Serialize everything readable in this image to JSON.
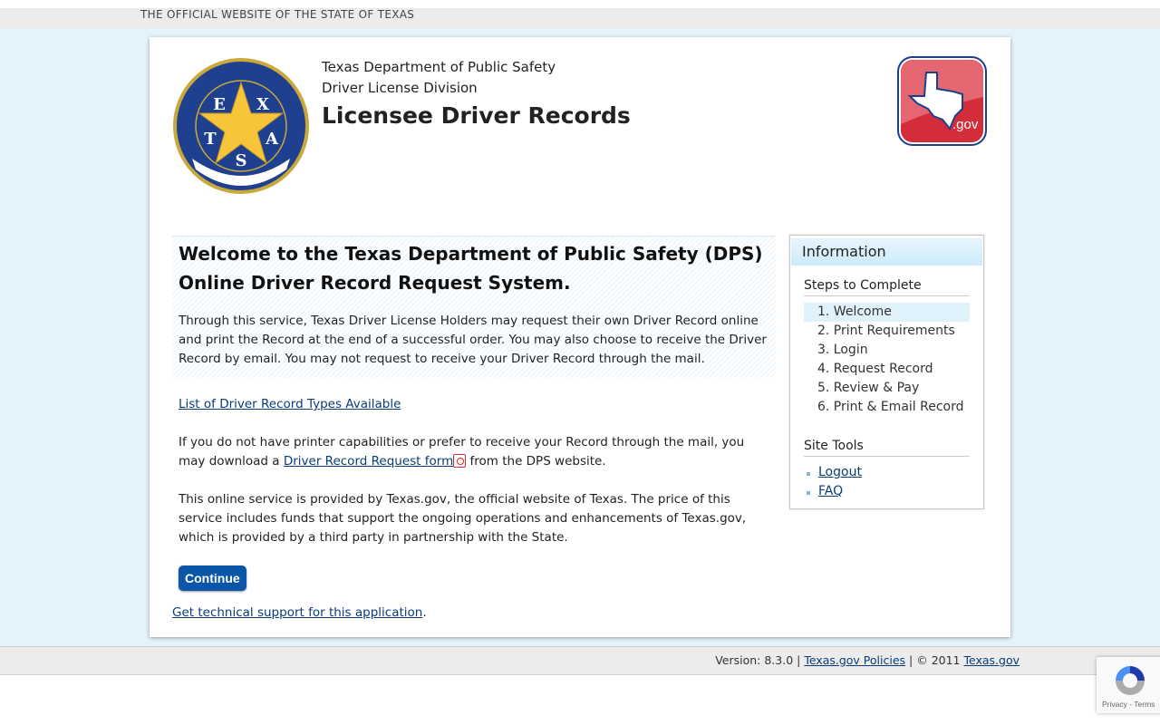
{
  "topbar": {
    "text": "THE OFFICIAL WEBSITE OF THE STATE OF TEXAS"
  },
  "header": {
    "agency": "Texas Department of Public Safety",
    "division": "Driver License Division",
    "title": "Licensee Driver Records",
    "seal_text": "DEPARTMENT OF PUBLIC SAFETY TEXAS COURTESY · SERVICE · PROTECTION",
    "logo_text": ".gov"
  },
  "main": {
    "heading": "Welcome to the Texas Department of Public Safety (DPS) Online Driver Record Request System.",
    "intro": "Through this service, Texas Driver License Holders may request their own Driver Record online and print the Record at the end of a successful order. You may also choose to receive the Driver Record by email. You may not request to receive your Driver Record through the mail.",
    "types_link": "List of Driver Record Types Available",
    "mail_pre": "If you do not have printer capabilities or prefer to receive your Record through the mail, you may download a ",
    "form_link": "Driver Record Request form",
    "mail_post": " from the DPS website.",
    "service": "This online service is provided by Texas.gov, the official website of Texas. The price of this service includes funds that support the ongoing operations and enhancements of Texas.gov, which is provided by a third party in partnership with the State.",
    "continue": "Continue",
    "support_link": "Get technical support for this application",
    "support_post": "."
  },
  "sidebar": {
    "title": "Information",
    "steps_title": "Steps to Complete",
    "steps": [
      "1. Welcome",
      "2. Print Requirements",
      "3. Login",
      "4. Request Record",
      "5. Review & Pay",
      "6. Print & Email Record"
    ],
    "current_step": 1,
    "tools_title": "Site Tools",
    "tools": [
      "Logout",
      "FAQ"
    ]
  },
  "footer": {
    "version": "Version: 8.3.0",
    "sep": " | ",
    "policies": "Texas.gov Policies",
    "copyright": "© 2011 ",
    "texasgov": "Texas.gov"
  },
  "recaptcha": {
    "label": "Privacy - Terms"
  },
  "colors": {
    "button": "#0b56a8",
    "link": "#0a3c78",
    "background": "#e4f3fb",
    "highlight": "#dff1fb"
  }
}
